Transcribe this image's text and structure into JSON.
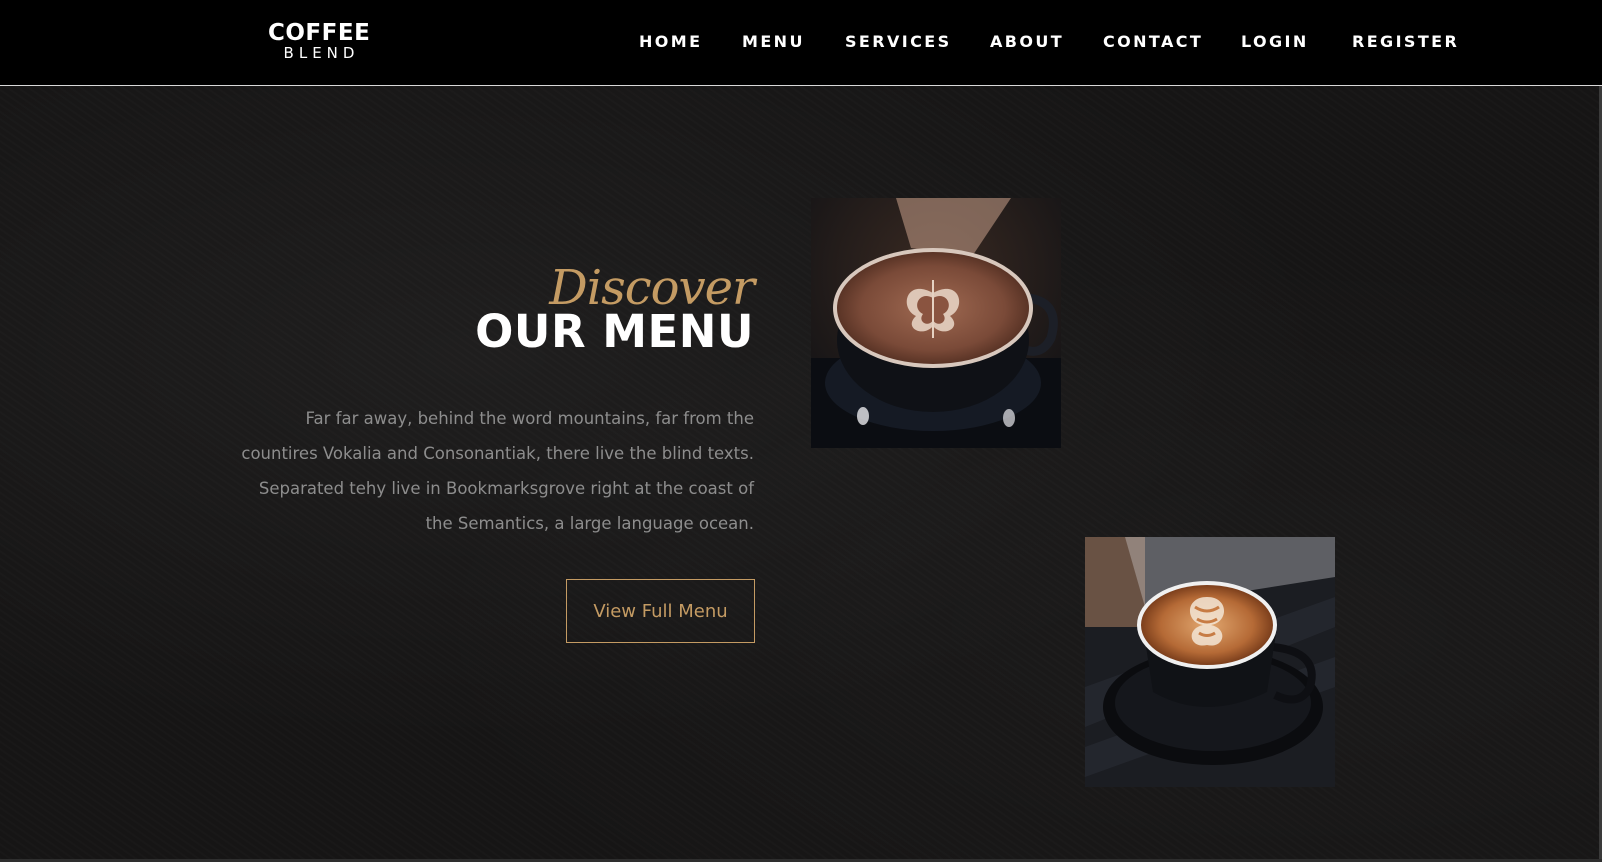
{
  "brand": {
    "line1": "COFFEE",
    "line2": "BLEND"
  },
  "nav": {
    "items": [
      {
        "label": "HOME"
      },
      {
        "label": "MENU"
      },
      {
        "label": "SERVICES"
      },
      {
        "label": "ABOUT"
      },
      {
        "label": "CONTACT"
      },
      {
        "label": "LOGIN"
      },
      {
        "label": "REGISTER"
      }
    ]
  },
  "hero": {
    "subheading": "Discover",
    "heading": "OUR MENU",
    "description": "Far far away, behind the word mountains, far from the countires Vokalia and Consonantiak, there live the blind texts. Separated tehy live in Bookmarksgrove right at the coast of the Semantics, a large language ocean.",
    "button_label": "View Full Menu"
  },
  "images": [
    {
      "name": "latte-art-mocha-photo"
    },
    {
      "name": "latte-art-cappuccino-photo"
    }
  ],
  "colors": {
    "accent": "#c49b63",
    "nav_background": "#000000",
    "page_background": "#161515",
    "body_text": "#8d8d8d"
  }
}
